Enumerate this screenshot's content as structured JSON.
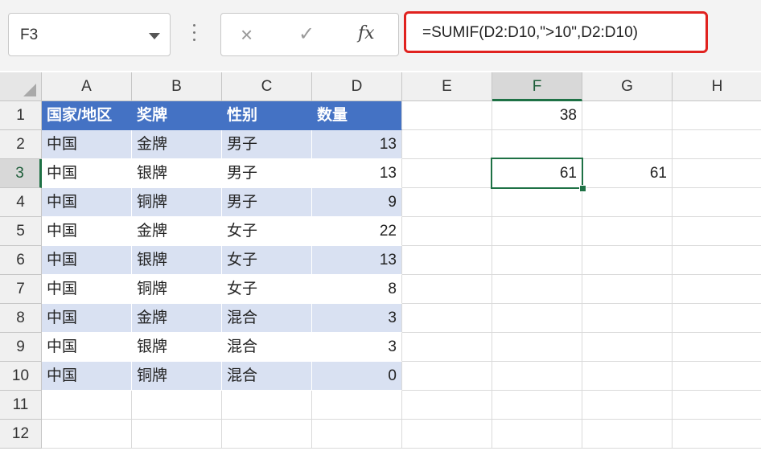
{
  "name_box": {
    "value": "F3"
  },
  "formula_bar": {
    "cancel_icon": "×",
    "enter_icon": "✓",
    "fx_label": "fx",
    "formula": "=SUMIF(D2:D10,\">10\",D2:D10)"
  },
  "columns": [
    "A",
    "B",
    "C",
    "D",
    "E",
    "F",
    "G",
    "H"
  ],
  "rows": [
    "1",
    "2",
    "3",
    "4",
    "5",
    "6",
    "7",
    "8",
    "9",
    "10",
    "11",
    "12"
  ],
  "table": {
    "headers": [
      "国家/地区",
      "奖牌",
      "性别",
      "数量"
    ],
    "rows": [
      [
        "中国",
        "金牌",
        "男子",
        "13"
      ],
      [
        "中国",
        "银牌",
        "男子",
        "13"
      ],
      [
        "中国",
        "铜牌",
        "男子",
        "9"
      ],
      [
        "中国",
        "金牌",
        "女子",
        "22"
      ],
      [
        "中国",
        "银牌",
        "女子",
        "13"
      ],
      [
        "中国",
        "铜牌",
        "女子",
        "8"
      ],
      [
        "中国",
        "金牌",
        "混合",
        "3"
      ],
      [
        "中国",
        "银牌",
        "混合",
        "3"
      ],
      [
        "中国",
        "铜牌",
        "混合",
        "0"
      ]
    ]
  },
  "extra_cells": {
    "F1": "38",
    "F3": "61",
    "G3": "61"
  },
  "selected_cell": "F3",
  "colors": {
    "header_fill": "#4472c4",
    "band_fill": "#d9e1f2",
    "selection": "#1e7145",
    "highlight_border": "#e0221f"
  }
}
